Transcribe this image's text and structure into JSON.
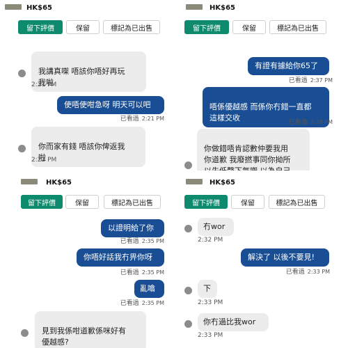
{
  "listing": {
    "price": "HK$65"
  },
  "actions": {
    "review": "留下評價",
    "reserve": "保留",
    "mark_sold": "標記為已出售"
  },
  "panels": [
    {
      "messages": [
        {
          "dir": "in",
          "text": "我講真㗎 唔該你唔好再玩\n我啦",
          "time": "2:21 PM"
        },
        {
          "dir": "out",
          "text": "使唔使咁急呀 明天可以吧",
          "seen": "已看過",
          "time": "2:21 PM"
        },
        {
          "dir": "in",
          "text": "你而家有錢 唔該你俾返我\n啦",
          "time": "2:22 PM"
        }
      ]
    },
    {
      "messages": [
        {
          "dir": "out",
          "text": "有證有據給你65了",
          "seen": "已看過",
          "time": "2:37 PM"
        },
        {
          "dir": "out",
          "text": "唔係優越感 而係你冇錯一直都\n這樣交收",
          "seen": "已看過",
          "time": "2:38 PM"
        },
        {
          "dir": "in",
          "text": "你做錯唔肯認數仲要我用\n你道歉 我廢撚事同你拗所\n以先低聲下氣㗎 以為自己\n高腳 咪撚玩啦"
        }
      ]
    },
    {
      "messages": [
        {
          "dir": "out",
          "text": "以證明給了你",
          "seen": "已看過",
          "time": "2:35 PM"
        },
        {
          "dir": "out",
          "text": "你唔好話我冇畀你呀",
          "seen": "已看過",
          "time": "2:35 PM"
        },
        {
          "dir": "out",
          "text": "亂噏",
          "seen": "已看過",
          "time": "2:35 PM"
        },
        {
          "dir": "in",
          "text": "見到我係咁道歉係咪好有\n優越感?"
        }
      ]
    },
    {
      "messages": [
        {
          "dir": "in",
          "text": "冇wor",
          "time": "2:32 PM"
        },
        {
          "dir": "out",
          "text": "解決了 以後不要見!",
          "seen": "已看過",
          "time": "2:33 PM"
        },
        {
          "dir": "in",
          "text": "下",
          "time": "2:33 PM"
        },
        {
          "dir": "in",
          "text": "你冇過比我wor",
          "time": "2:33 PM"
        }
      ]
    }
  ]
}
